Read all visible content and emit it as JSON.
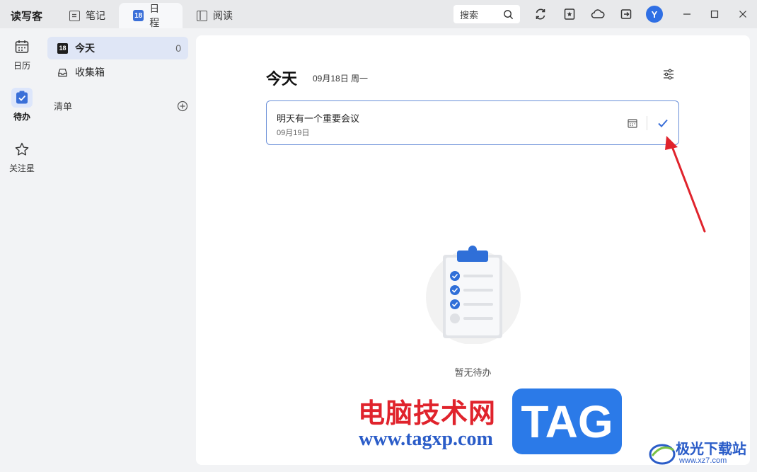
{
  "app": {
    "name": "读写客"
  },
  "tabs": [
    {
      "label": "笔记",
      "icon": "note-icon",
      "active": false
    },
    {
      "label": "日程",
      "icon": "calendar-18-icon",
      "badge": "18",
      "active": true
    },
    {
      "label": "阅读",
      "icon": "book-icon",
      "active": false
    }
  ],
  "toolbar": {
    "search_placeholder": "搜索",
    "avatar_letter": "Y",
    "icons": [
      "sync-icon",
      "star-note-icon",
      "cloud-icon",
      "export-icon"
    ]
  },
  "rail": [
    {
      "label": "日历",
      "icon": "calendar-icon",
      "active": false
    },
    {
      "label": "待办",
      "icon": "todo-check-icon",
      "active": true
    },
    {
      "label": "关注星",
      "icon": "star-icon",
      "active": false
    }
  ],
  "nav": {
    "today": {
      "label": "今天",
      "badge": "18",
      "count": "0"
    },
    "inbox": {
      "label": "收集箱"
    },
    "list_header": "清单"
  },
  "main": {
    "title": "今天",
    "date": "09月18日 周一",
    "task": {
      "title": "明天有一个重要会议",
      "date": "09月19日"
    },
    "empty_text": "暂无待办"
  },
  "watermark": {
    "cn": "电脑技术网",
    "url": "www.tagxp.com",
    "tag": "TAG",
    "logo_text": "极光下载站",
    "logo_url": "www.xz7.com"
  },
  "colors": {
    "accent": "#3a6fd8",
    "arrow": "#e0232c",
    "card_border": "#6a8fd8"
  }
}
